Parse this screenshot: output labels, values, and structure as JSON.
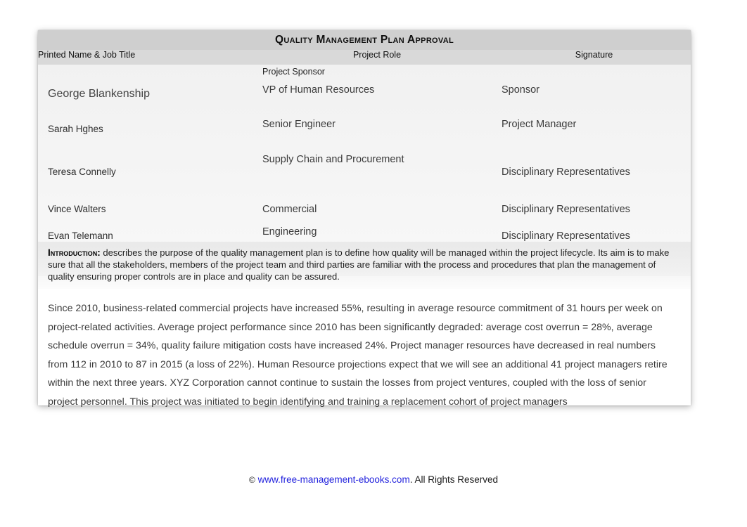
{
  "document": {
    "title": "Quality Management Plan Approval",
    "table": {
      "columns": [
        {
          "key": "name",
          "label": "Printed Name  & Job Title"
        },
        {
          "key": "role",
          "label": "Project Role"
        },
        {
          "key": "signature",
          "label": "Signature"
        }
      ],
      "rows": [
        {
          "name": "",
          "role_top": "Project Sponsor",
          "role": "VP of Human Resources",
          "signature": "Sponsor"
        },
        {
          "name": "George Blankenship",
          "role_top": "",
          "role": "",
          "signature": ""
        },
        {
          "name": "Sarah Hghes",
          "role_top": "",
          "role": "Senior Engineer",
          "signature": "Project Manager"
        },
        {
          "name": "",
          "role_top": "",
          "role": "Supply Chain and Procurement",
          "signature": ""
        },
        {
          "name": "Teresa Connelly",
          "role_top": "",
          "role": "",
          "signature": "Disciplinary Representatives"
        },
        {
          "name": "Vince Walters",
          "role_top": "",
          "role": "Commercial",
          "signature": "Disciplinary Representatives"
        },
        {
          "name": "Evan Telemann",
          "role_top": "",
          "role": "Engineering",
          "signature": "Disciplinary Representatives"
        }
      ]
    },
    "introduction": {
      "label": "Introduction:",
      "text": " describes the purpose of the quality management plan is to define how quality will be managed within the project lifecycle. Its aim is to make sure that all the stakeholders, members of the project team and third parties are familiar with the process and procedures that plan the management of quality ensuring proper controls are in place and quality can be assured."
    },
    "body": {
      "text": "Since 2010, business-related commercial projects have increased 55%, resulting in average resource commitment of 31 hours per week on project-related activities. Average project performance since 2010 has been significantly degraded: average cost overrun = 28%, average schedule overrun = 34%, quality failure mitigation costs have increased 24%. Project manager resources have decreased in real numbers from 112 in 2010 to 87 in 2015 (a loss of 22%). Human Resource projections expect that we will see an additional 41 project managers retire within the next three years. XYZ Corporation cannot continue to sustain the losses from project ventures, coupled with the loss of senior project personnel. This project was initiated to begin identifying and training a replacement cohort of project managers"
    }
  },
  "footer": {
    "copyright_mark": "©",
    "link_text": "www.free-management-ebooks.com",
    "rights_text": ". All Rights Reserved",
    "link_color": "#2222dd"
  }
}
